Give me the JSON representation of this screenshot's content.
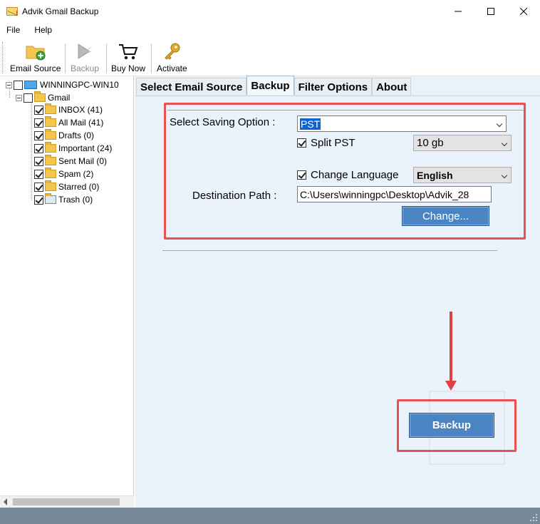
{
  "window": {
    "title": "Advik Gmail Backup"
  },
  "menu": {
    "items": [
      "File",
      "Help"
    ]
  },
  "toolbar": {
    "email_source": "Email Source",
    "backup": "Backup",
    "buy_now": "Buy Now",
    "activate": "Activate"
  },
  "tree": {
    "root": "WINNINGPC-WIN10",
    "account": "Gmail",
    "folders": [
      {
        "label": "INBOX (41)",
        "checked": true
      },
      {
        "label": "All Mail (41)",
        "checked": true
      },
      {
        "label": "Drafts (0)",
        "checked": true
      },
      {
        "label": "Important (24)",
        "checked": true
      },
      {
        "label": "Sent Mail (0)",
        "checked": true
      },
      {
        "label": "Spam (2)",
        "checked": true
      },
      {
        "label": "Starred (0)",
        "checked": true
      },
      {
        "label": "Trash (0)",
        "checked": true
      }
    ]
  },
  "tabs": {
    "select_email_source": "Select Email Source",
    "backup": "Backup",
    "filter_options": "Filter Options",
    "about": "About"
  },
  "backup_panel": {
    "saving_option_label": "Select Saving Option :",
    "saving_option_value": "PST",
    "split_pst_label": "Split PST",
    "split_pst_checked": true,
    "split_size_value": "10 gb",
    "change_language_label": "Change Language",
    "change_language_checked": true,
    "language_value": "English",
    "destination_label": "Destination Path :",
    "destination_value": "C:\\Users\\winningpc\\Desktop\\Advik_28",
    "change_button": "Change...",
    "backup_button": "Backup"
  },
  "colors": {
    "highlight_red": "#e45252",
    "button_blue": "#4a84c2",
    "panel_bg": "#eaf3fb",
    "status_bar": "#788a99"
  }
}
